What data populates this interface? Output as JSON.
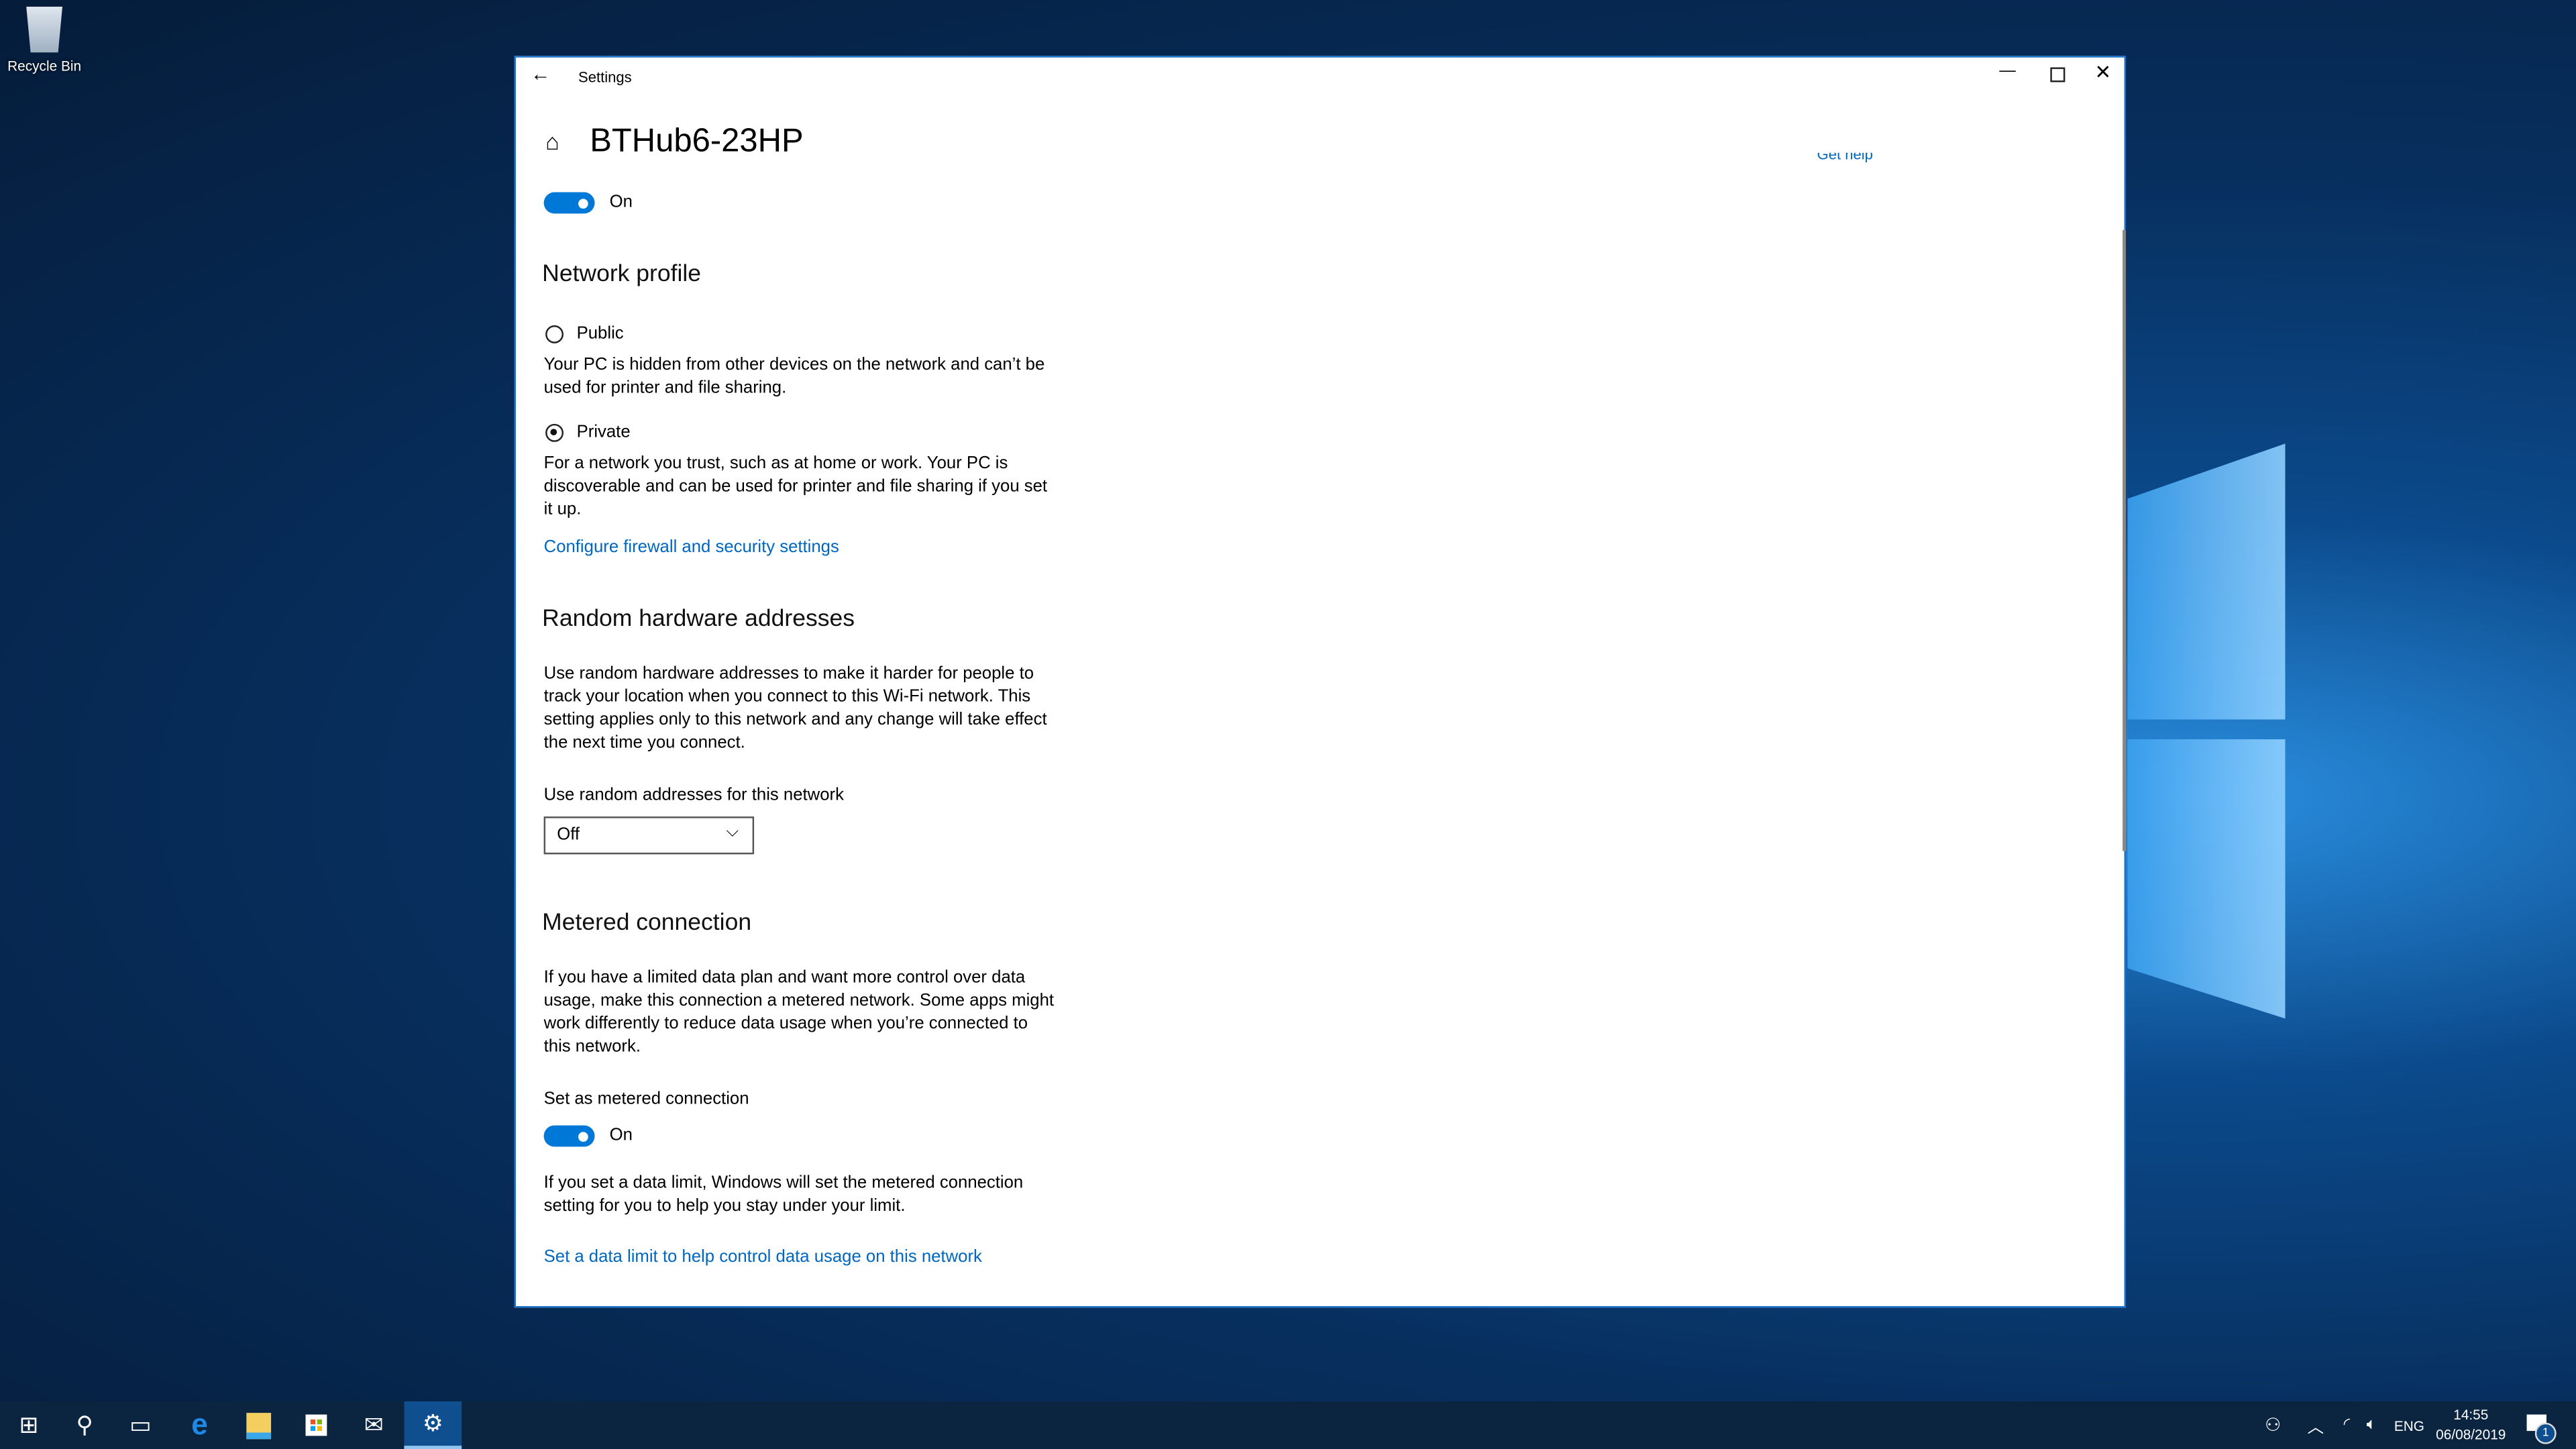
{
  "desktop": {
    "recycle_bin_label": "Recycle Bin"
  },
  "window": {
    "title": "Settings",
    "page_title": "BTHub6-23HP",
    "get_help_partial": "Get help"
  },
  "connect_toggle": {
    "state": "On",
    "on": true
  },
  "network_profile": {
    "heading": "Network profile",
    "options": [
      {
        "label": "Public",
        "selected": false,
        "desc_lines": [
          "Your PC is hidden from other devices on the network and can’t be",
          "used for printer and file sharing."
        ]
      },
      {
        "label": "Private",
        "selected": true,
        "desc_lines": [
          "For a network you trust, such as at home or work. Your PC is",
          "discoverable and can be used for printer and file sharing if you set",
          "it up."
        ]
      }
    ],
    "firewall_link": "Configure firewall and security settings"
  },
  "random_hw": {
    "heading": "Random hardware addresses",
    "desc_lines": [
      "Use random hardware addresses to make it harder for people to",
      "track your location when you connect to this Wi-Fi network. This",
      "setting applies only to this network and any change will take effect",
      "the next time you connect."
    ],
    "dropdown_label": "Use random addresses for this network",
    "dropdown_value": "Off"
  },
  "metered": {
    "heading": "Metered connection",
    "desc_lines": [
      "If you have a limited data plan and want more control over data",
      "usage, make this connection a metered network. Some apps might",
      "work differently to reduce data usage when you’re connected to",
      "this network."
    ],
    "toggle_label": "Set as metered connection",
    "toggle_state": "On",
    "note_lines": [
      "If you set a data limit, Windows will set the metered connection",
      "setting for you to help you stay under your limit."
    ],
    "data_limit_link": "Set a data limit to help control data usage on this network"
  },
  "taskbar": {
    "apps": [
      "start-icon",
      "search-icon",
      "task-view-icon",
      "edge-icon",
      "file-explorer-icon",
      "store-icon",
      "mail-icon",
      "settings-icon"
    ],
    "active_app": "settings-icon",
    "language": "ENG",
    "time": "14:55",
    "date": "06/08/2019",
    "notification_count": "1"
  },
  "colors": {
    "accent": "#0078d7",
    "link": "#0067c0",
    "taskbar": "#0b2440"
  }
}
